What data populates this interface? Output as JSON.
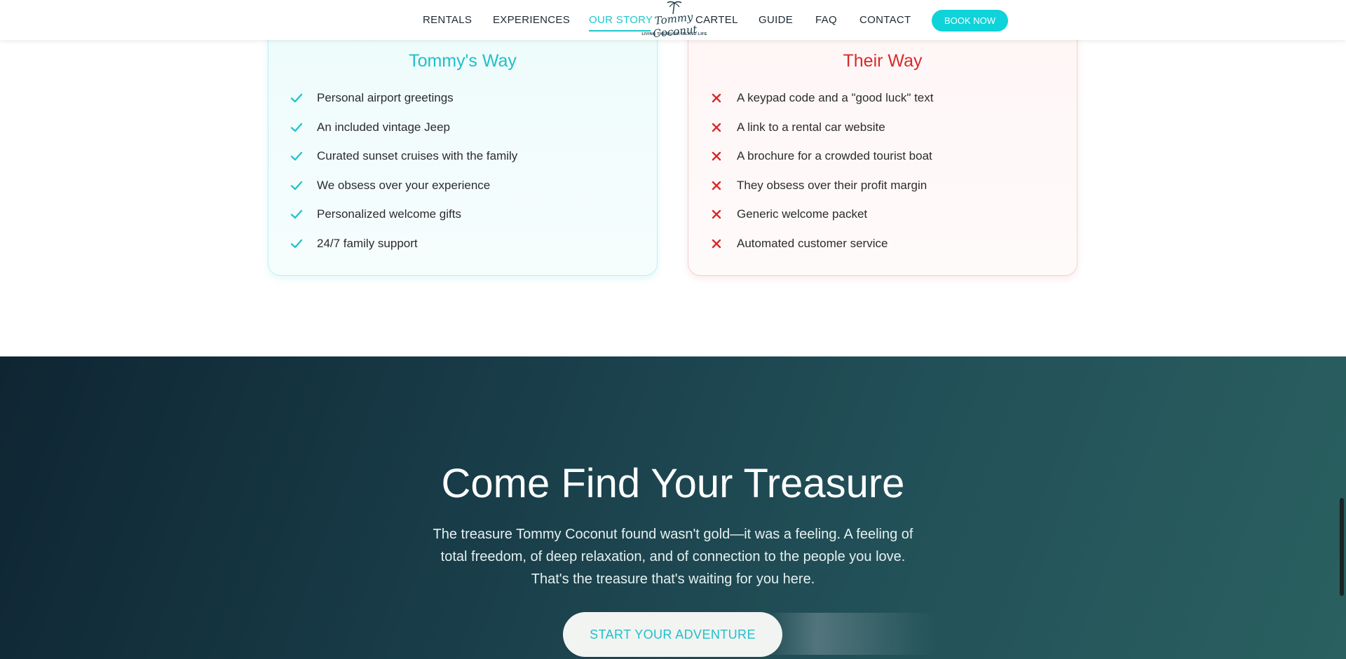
{
  "nav": {
    "links": [
      "RENTALS",
      "EXPERIENCES",
      "OUR STORY",
      "CARTEL",
      "GUIDE",
      "FAQ",
      "CONTACT"
    ],
    "active": "OUR STORY",
    "book_label": "BOOK NOW",
    "logo": {
      "text": "Tommy Coconut",
      "tagline": "LIVING THE DUSHI ISLAND LIFE"
    }
  },
  "comparison": {
    "good": {
      "title": "Tommy's Way",
      "items": [
        "Personal airport greetings",
        "An included vintage Jeep",
        "Curated sunset cruises with the family",
        "We obsess over your experience",
        "Personalized welcome gifts",
        "24/7 family support"
      ]
    },
    "bad": {
      "title": "Their Way",
      "items": [
        "A keypad code and a \"good luck\" text",
        "A link to a rental car website",
        "A brochure for a crowded tourist boat",
        "They obsess over their profit margin",
        "Generic welcome packet",
        "Automated customer service"
      ]
    }
  },
  "hero": {
    "title": "Come Find Your Treasure",
    "text": "The treasure Tommy Coconut found wasn't gold—it was a feeling. A feeling of total freedom, of deep relaxation, and of connection to the people you love. That's the treasure that's waiting for you here.",
    "cta_label": "START YOUR ADVENTURE"
  },
  "colors": {
    "accent": "#1fc6cf",
    "negative": "#d82a2a",
    "hero_dark": "#0f2532",
    "hero_light": "#2a6060"
  }
}
